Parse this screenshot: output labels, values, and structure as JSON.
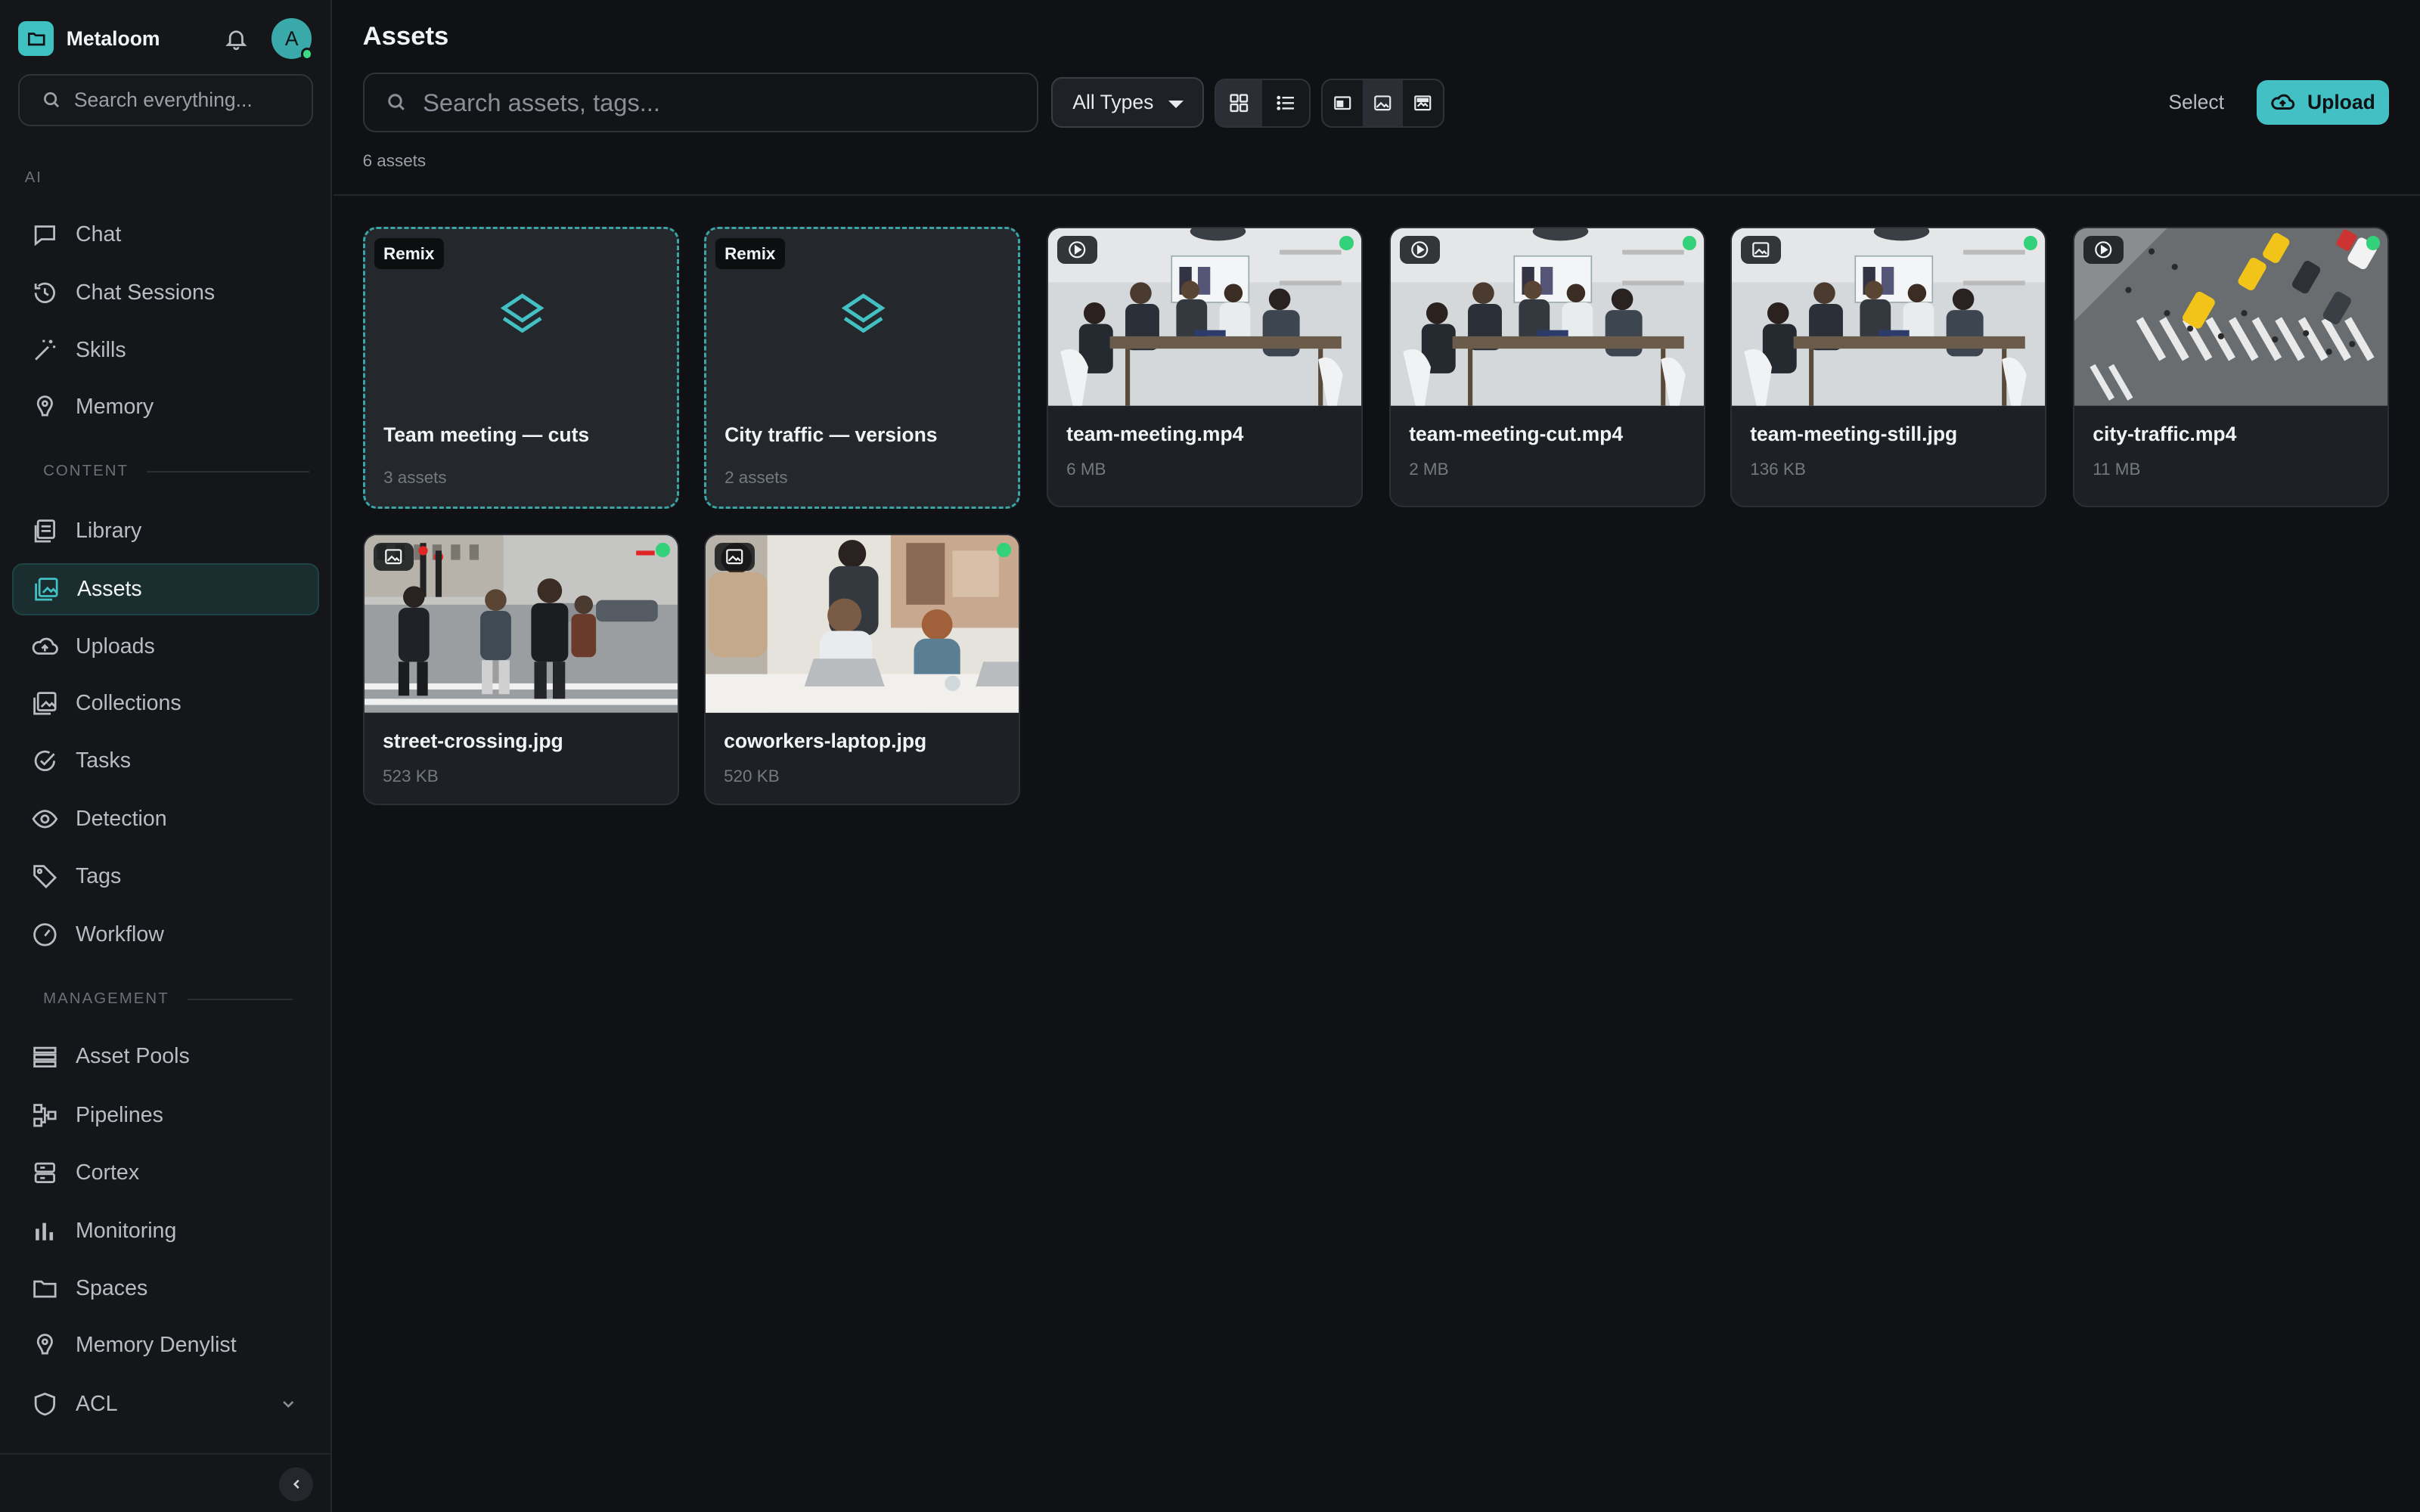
{
  "app": {
    "name": "Metaloom",
    "avatar_initial": "A"
  },
  "sidebar": {
    "search_placeholder": "Search everything...",
    "sections": {
      "ai": "AI",
      "content": "CONTENT",
      "management": "MANAGEMENT"
    },
    "ai_items": [
      {
        "label": "Chat",
        "icon": "chat-icon"
      },
      {
        "label": "Chat Sessions",
        "icon": "history-icon"
      },
      {
        "label": "Skills",
        "icon": "wand-icon"
      },
      {
        "label": "Memory",
        "icon": "memory-icon"
      }
    ],
    "content_items": [
      {
        "label": "Library",
        "icon": "library-icon"
      },
      {
        "label": "Assets",
        "icon": "image-stack-icon",
        "active": true
      },
      {
        "label": "Uploads",
        "icon": "cloud-upload-icon"
      },
      {
        "label": "Collections",
        "icon": "collection-icon"
      },
      {
        "label": "Tasks",
        "icon": "check-circle-icon"
      },
      {
        "label": "Detection",
        "icon": "eye-icon"
      },
      {
        "label": "Tags",
        "icon": "tag-icon"
      },
      {
        "label": "Workflow",
        "icon": "gauge-icon"
      }
    ],
    "management_items": [
      {
        "label": "Asset Pools",
        "icon": "pool-icon"
      },
      {
        "label": "Pipelines",
        "icon": "pipeline-icon"
      },
      {
        "label": "Cortex",
        "icon": "server-icon"
      },
      {
        "label": "Monitoring",
        "icon": "bar-chart-icon"
      },
      {
        "label": "Spaces",
        "icon": "folder-icon"
      },
      {
        "label": "Memory Denylist",
        "icon": "memory-icon"
      },
      {
        "label": "ACL",
        "icon": "shield-icon"
      }
    ]
  },
  "main": {
    "title": "Assets",
    "search_placeholder": "Search assets, tags...",
    "type_filter": "All Types",
    "select_label": "Select",
    "upload_label": "Upload",
    "count_label": "6 assets"
  },
  "cards": [
    {
      "kind": "group",
      "badge": "Remix",
      "name": "Team meeting — cuts",
      "meta": "3 assets"
    },
    {
      "kind": "group",
      "badge": "Remix",
      "name": "City traffic — versions",
      "meta": "2 assets"
    },
    {
      "kind": "video",
      "name": "team-meeting.mp4",
      "meta": "6 MB",
      "thumb": "meeting"
    },
    {
      "kind": "video",
      "name": "team-meeting-cut.mp4",
      "meta": "2 MB",
      "thumb": "meeting"
    },
    {
      "kind": "image",
      "name": "team-meeting-still.jpg",
      "meta": "136 KB",
      "thumb": "meeting"
    },
    {
      "kind": "video",
      "name": "city-traffic.mp4",
      "meta": "11 MB",
      "thumb": "traffic"
    },
    {
      "kind": "image",
      "name": "street-crossing.jpg",
      "meta": "523 KB",
      "thumb": "street"
    },
    {
      "kind": "image",
      "name": "coworkers-laptop.jpg",
      "meta": "520 KB",
      "thumb": "coworkers"
    }
  ],
  "colors": {
    "accent": "#43c0c3",
    "status_ok": "#33d17a",
    "background": "#0f1114"
  }
}
